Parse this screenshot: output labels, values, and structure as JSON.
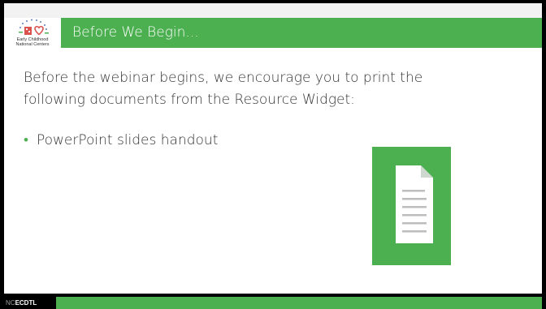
{
  "header": {
    "logo": {
      "line1": "Early Childhood",
      "line2": "National Centers"
    },
    "title": "Before We Begin..."
  },
  "content": {
    "intro": "Before the webinar begins, we encourage you to print the following documents from the Resource Widget:",
    "bullet_char": "•",
    "bullets": [
      {
        "label": "PowerPoint slides handout"
      }
    ],
    "document_icon": "document-icon"
  },
  "footer": {
    "logo_prefix": "NC",
    "logo_strong": "ECDTL"
  },
  "colors": {
    "accent_green": "#4caf50",
    "header_bg": "#f2f2f2",
    "frame": "#000000",
    "text": "#333333"
  }
}
